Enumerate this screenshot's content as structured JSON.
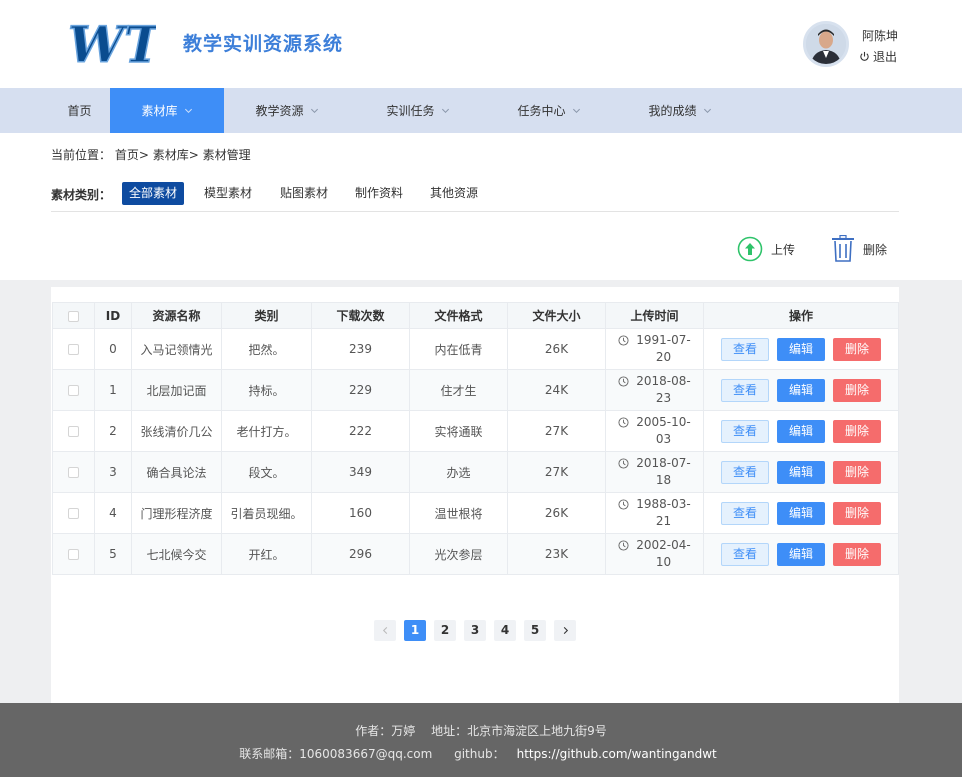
{
  "header": {
    "logo_text": "WT",
    "site_title": "教学实训资源系统",
    "user_name": "阿陈坤",
    "logout_label": "退出"
  },
  "nav": {
    "items": [
      {
        "label": "首页",
        "has_dropdown": false
      },
      {
        "label": "素材库",
        "has_dropdown": true,
        "active": true
      },
      {
        "label": "教学资源",
        "has_dropdown": true
      },
      {
        "label": "实训任务",
        "has_dropdown": true
      },
      {
        "label": "任务中心",
        "has_dropdown": true
      },
      {
        "label": "我的成绩",
        "has_dropdown": true
      }
    ]
  },
  "breadcrumb": {
    "prefix": "当前位置：",
    "items": [
      "首页>",
      "素材库>",
      "素材管理"
    ]
  },
  "categories": {
    "label": "素材类别：",
    "items": [
      "全部素材",
      "模型素材",
      "贴图素材",
      "制作资料",
      "其他资源"
    ],
    "active": "全部素材"
  },
  "toolbar": {
    "upload_label": "上传",
    "delete_label": "删除"
  },
  "table": {
    "headers": [
      "",
      "ID",
      "资源名称",
      "类别",
      "下载次数",
      "文件格式",
      "文件大小",
      "上传时间",
      "操作"
    ],
    "rows": [
      {
        "id": "0",
        "name": "入马记领情光",
        "category": "把然。",
        "downloads": "239",
        "format": "内在低青",
        "size": "26K",
        "time": "1991-07-20"
      },
      {
        "id": "1",
        "name": "北层加记面",
        "category": "持标。",
        "downloads": "229",
        "format": "住才生",
        "size": "24K",
        "time": "2018-08-23"
      },
      {
        "id": "2",
        "name": "张线清价几公",
        "category": "老什打方。",
        "downloads": "222",
        "format": "实将通联",
        "size": "27K",
        "time": "2005-10-03"
      },
      {
        "id": "3",
        "name": "确合具论法",
        "category": "段文。",
        "downloads": "349",
        "format": "办选",
        "size": "27K",
        "time": "2018-07-18"
      },
      {
        "id": "4",
        "name": "门理形程济度",
        "category": "引着员现细。",
        "downloads": "160",
        "format": "温世根将",
        "size": "26K",
        "time": "1988-03-21"
      },
      {
        "id": "5",
        "name": "七北候今交",
        "category": "开红。",
        "downloads": "296",
        "format": "光次参层",
        "size": "23K",
        "time": "2002-04-10"
      }
    ],
    "actions": {
      "view": "查看",
      "edit": "编辑",
      "delete": "删除"
    }
  },
  "pagination": {
    "pages": [
      "1",
      "2",
      "3",
      "4",
      "5"
    ],
    "current": "1"
  },
  "footer": {
    "author": "作者：万婷",
    "address": "地址：北京市海淀区上地九街9号",
    "email": "联系邮箱：1060083667@qq.com",
    "github_label": "github：",
    "github_url": "https://github.com/wantingandwt"
  },
  "colors": {
    "primary": "#3e8ef7",
    "nav_bg": "#d6dff0",
    "category_active": "#0e4ba0",
    "danger": "#f56c6c",
    "footer_bg": "#666666",
    "title": "#3d7fd9"
  }
}
